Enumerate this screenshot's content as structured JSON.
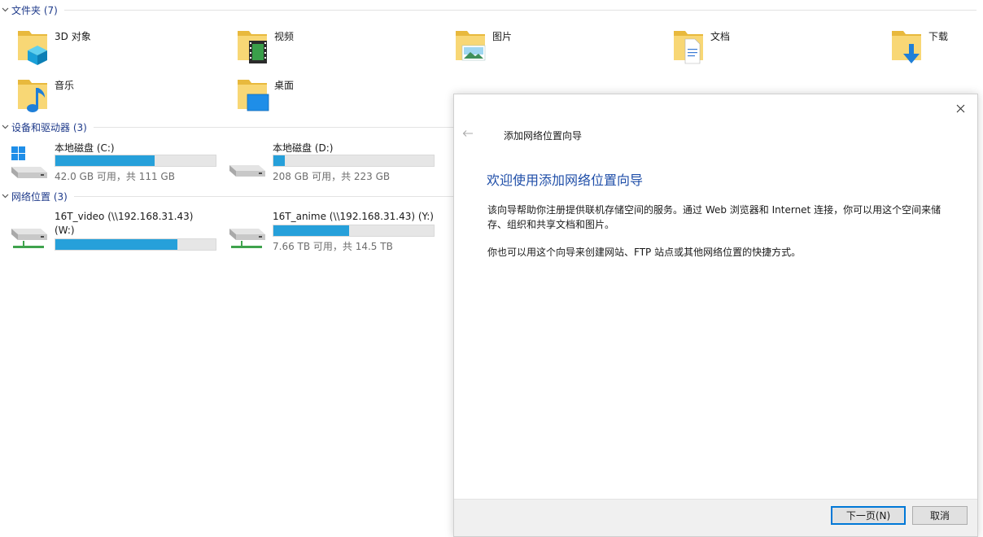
{
  "sections": {
    "folders": {
      "title": "文件夹 (7)"
    },
    "devices": {
      "title": "设备和驱动器 (3)"
    },
    "network": {
      "title": "网络位置 (3)"
    }
  },
  "folders": [
    {
      "label": "3D 对象",
      "icon": "3d-objects-icon"
    },
    {
      "label": "视频",
      "icon": "video-icon"
    },
    {
      "label": "图片",
      "icon": "pictures-icon"
    },
    {
      "label": "文档",
      "icon": "documents-icon"
    },
    {
      "label": "下载",
      "icon": "downloads-icon"
    },
    {
      "label": "音乐",
      "icon": "music-icon"
    },
    {
      "label": "桌面",
      "icon": "desktop-icon"
    }
  ],
  "drives": [
    {
      "name": "本地磁盘 (C:)",
      "info": "42.0 GB 可用，共 111 GB",
      "used_fraction": 0.62
    },
    {
      "name": "本地磁盘 (D:)",
      "info": "208 GB 可用，共 223 GB",
      "used_fraction": 0.07
    }
  ],
  "network_locations": [
    {
      "name": "16T_video (\\\\192.168.31.43)",
      "name_line2": "(W:)",
      "info": "",
      "used_fraction": 0.76
    },
    {
      "name": "16T_anime (\\\\192.168.31.43) (Y:)",
      "info": "7.66 TB 可用，共 14.5 TB",
      "used_fraction": 0.47
    }
  ],
  "dialog": {
    "wizard_title": "添加网络位置向导",
    "heading": "欢迎使用添加网络位置向导",
    "paragraph1": "该向导帮助你注册提供联机存储空间的服务。通过 Web 浏览器和 Internet 连接，你可以用这个空间来储存、组织和共享文档和图片。",
    "paragraph2": "你也可以用这个向导来创建网站、FTP 站点或其他网络位置的快捷方式。",
    "next_label": "下一页(N)",
    "cancel_label": "取消"
  },
  "colors": {
    "section_title": "#1e3a8a",
    "bar_fill": "#26a0da",
    "heading": "#1f4ea8",
    "folder": "#f8d775"
  }
}
